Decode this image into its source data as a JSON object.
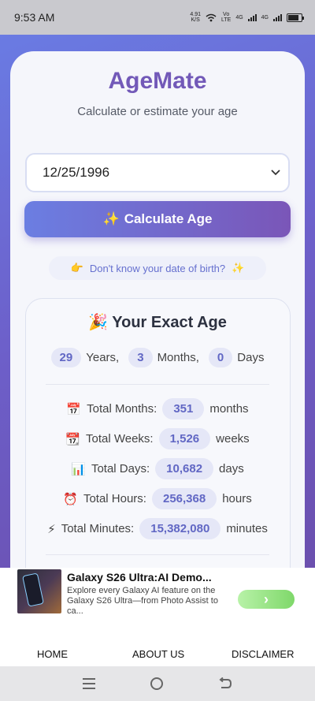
{
  "status_bar": {
    "time": "9:53 AM",
    "net_speed_value": "4.91",
    "net_speed_unit": "K/S",
    "volte_top": "Vo",
    "volte_bottom": "LTE",
    "network_1": "4G",
    "network_2": "4G"
  },
  "app": {
    "title": "AgeMate",
    "subtitle": "Calculate or estimate your age"
  },
  "form": {
    "date_value": "12/25/1996",
    "calculate_icon": "✨",
    "calculate_label": "Calculate Age",
    "dob_link_left_icon": "👉",
    "dob_link_label": "Don't know your date of birth?",
    "dob_link_right_icon": "✨"
  },
  "results": {
    "title_icon": "🎉",
    "title": "Your Exact Age",
    "years": "29",
    "years_label": "Years,",
    "months": "3",
    "months_label": "Months,",
    "days": "0",
    "days_label": "Days",
    "stats": [
      {
        "icon": "📅",
        "label": "Total Months:",
        "value": "351",
        "unit": "months"
      },
      {
        "icon": "📆",
        "label": "Total Weeks:",
        "value": "1,526",
        "unit": "weeks"
      },
      {
        "icon": "📊",
        "label": "Total Days:",
        "value": "10,682",
        "unit": "days"
      },
      {
        "icon": "⏰",
        "label": "Total Hours:",
        "value": "256,368",
        "unit": "hours"
      },
      {
        "icon": "⚡",
        "label": "Total Minutes:",
        "value": "15,382,080",
        "unit": "minutes"
      }
    ]
  },
  "ad": {
    "title": "Galaxy S26 Ultra:AI Demo...",
    "description": "Explore every Galaxy AI feature on the Galaxy S26 Ultra—from Photo Assist to ca...",
    "cta_icon": "›"
  },
  "footer": {
    "home": "HOME",
    "about": "ABOUT US",
    "disclaimer": "DISCLAIMER"
  }
}
